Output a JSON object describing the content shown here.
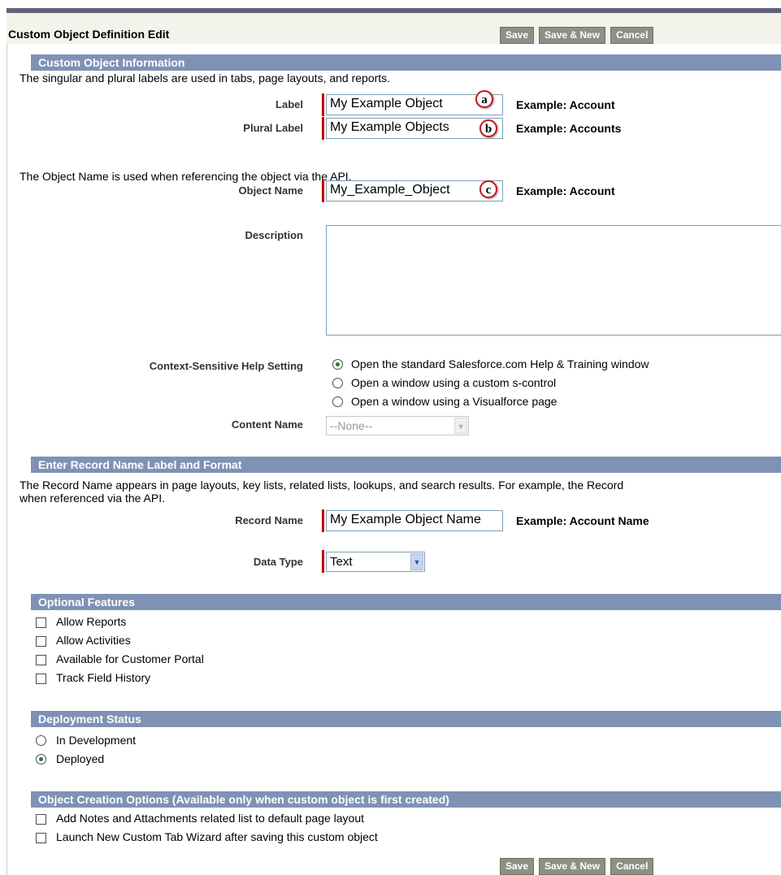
{
  "header": {
    "title": "Custom Object Definition Edit",
    "save": "Save",
    "save_new": "Save & New",
    "cancel": "Cancel"
  },
  "custom_object_info": {
    "heading": "Custom Object Information",
    "intro": "The singular and plural labels are used in tabs, page layouts, and reports.",
    "label_label": "Label",
    "label_value": "My Example Object",
    "label_example": "Example:  Account",
    "plural_label": "Plural Label",
    "plural_value": "My Example Objects",
    "plural_example": "Example:  Accounts",
    "api_intro": "The Object Name is used when referencing the object via the API.",
    "object_name_label": "Object Name",
    "object_name_value": "My_Example_Object",
    "object_name_example": "Example:  Account",
    "description_label": "Description",
    "help_label": "Context-Sensitive Help Setting",
    "help_options": [
      "Open the standard Salesforce.com Help & Training window",
      "Open a window using a custom s-control",
      "Open a window using a Visualforce page"
    ],
    "help_selected": 0,
    "content_name_label": "Content Name",
    "content_name_value": "--None--"
  },
  "callouts": {
    "a": "a",
    "b": "b",
    "c": "c"
  },
  "record_name": {
    "heading": "Enter Record Name Label and Format",
    "intro1": "The Record Name appears in page layouts, key lists, related lists, lookups, and search results. For example, the Record",
    "intro2": "when referenced via the API.",
    "record_name_label": "Record Name",
    "record_name_value": "My Example Object Name",
    "record_name_example": "Example:  Account Name",
    "data_type_label": "Data Type",
    "data_type_value": "Text"
  },
  "optional": {
    "heading": "Optional Features",
    "items": [
      "Allow Reports",
      "Allow Activities",
      "Available for Customer Portal",
      "Track Field History"
    ]
  },
  "deployment": {
    "heading": "Deployment Status",
    "options": [
      "In Development",
      "Deployed"
    ],
    "selected": 1
  },
  "creation": {
    "heading": "Object Creation Options (Available only when custom object is first created)",
    "items": [
      "Add Notes and Attachments related list to default page layout",
      "Launch New Custom Tab Wizard after saving this custom object"
    ]
  },
  "footer": {
    "save": "Save",
    "save_new": "Save & New",
    "cancel": "Cancel"
  }
}
